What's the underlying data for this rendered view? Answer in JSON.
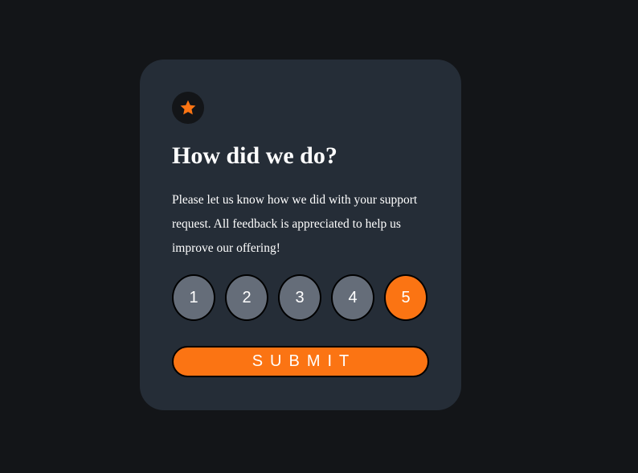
{
  "card": {
    "icon": "star-icon",
    "title": "How did we do?",
    "description": "Please let us know how we did with your support request. All feedback is appreciated to help us improve our offering!",
    "ratings": [
      "1",
      "2",
      "3",
      "4",
      "5"
    ],
    "selected_rating": "5",
    "submit_label": "SUBMIT"
  },
  "colors": {
    "page_background": "#131518",
    "card_background": "#252d37",
    "accent": "#fb7413",
    "rating_unselected": "#656d79",
    "text": "#ffffff"
  }
}
